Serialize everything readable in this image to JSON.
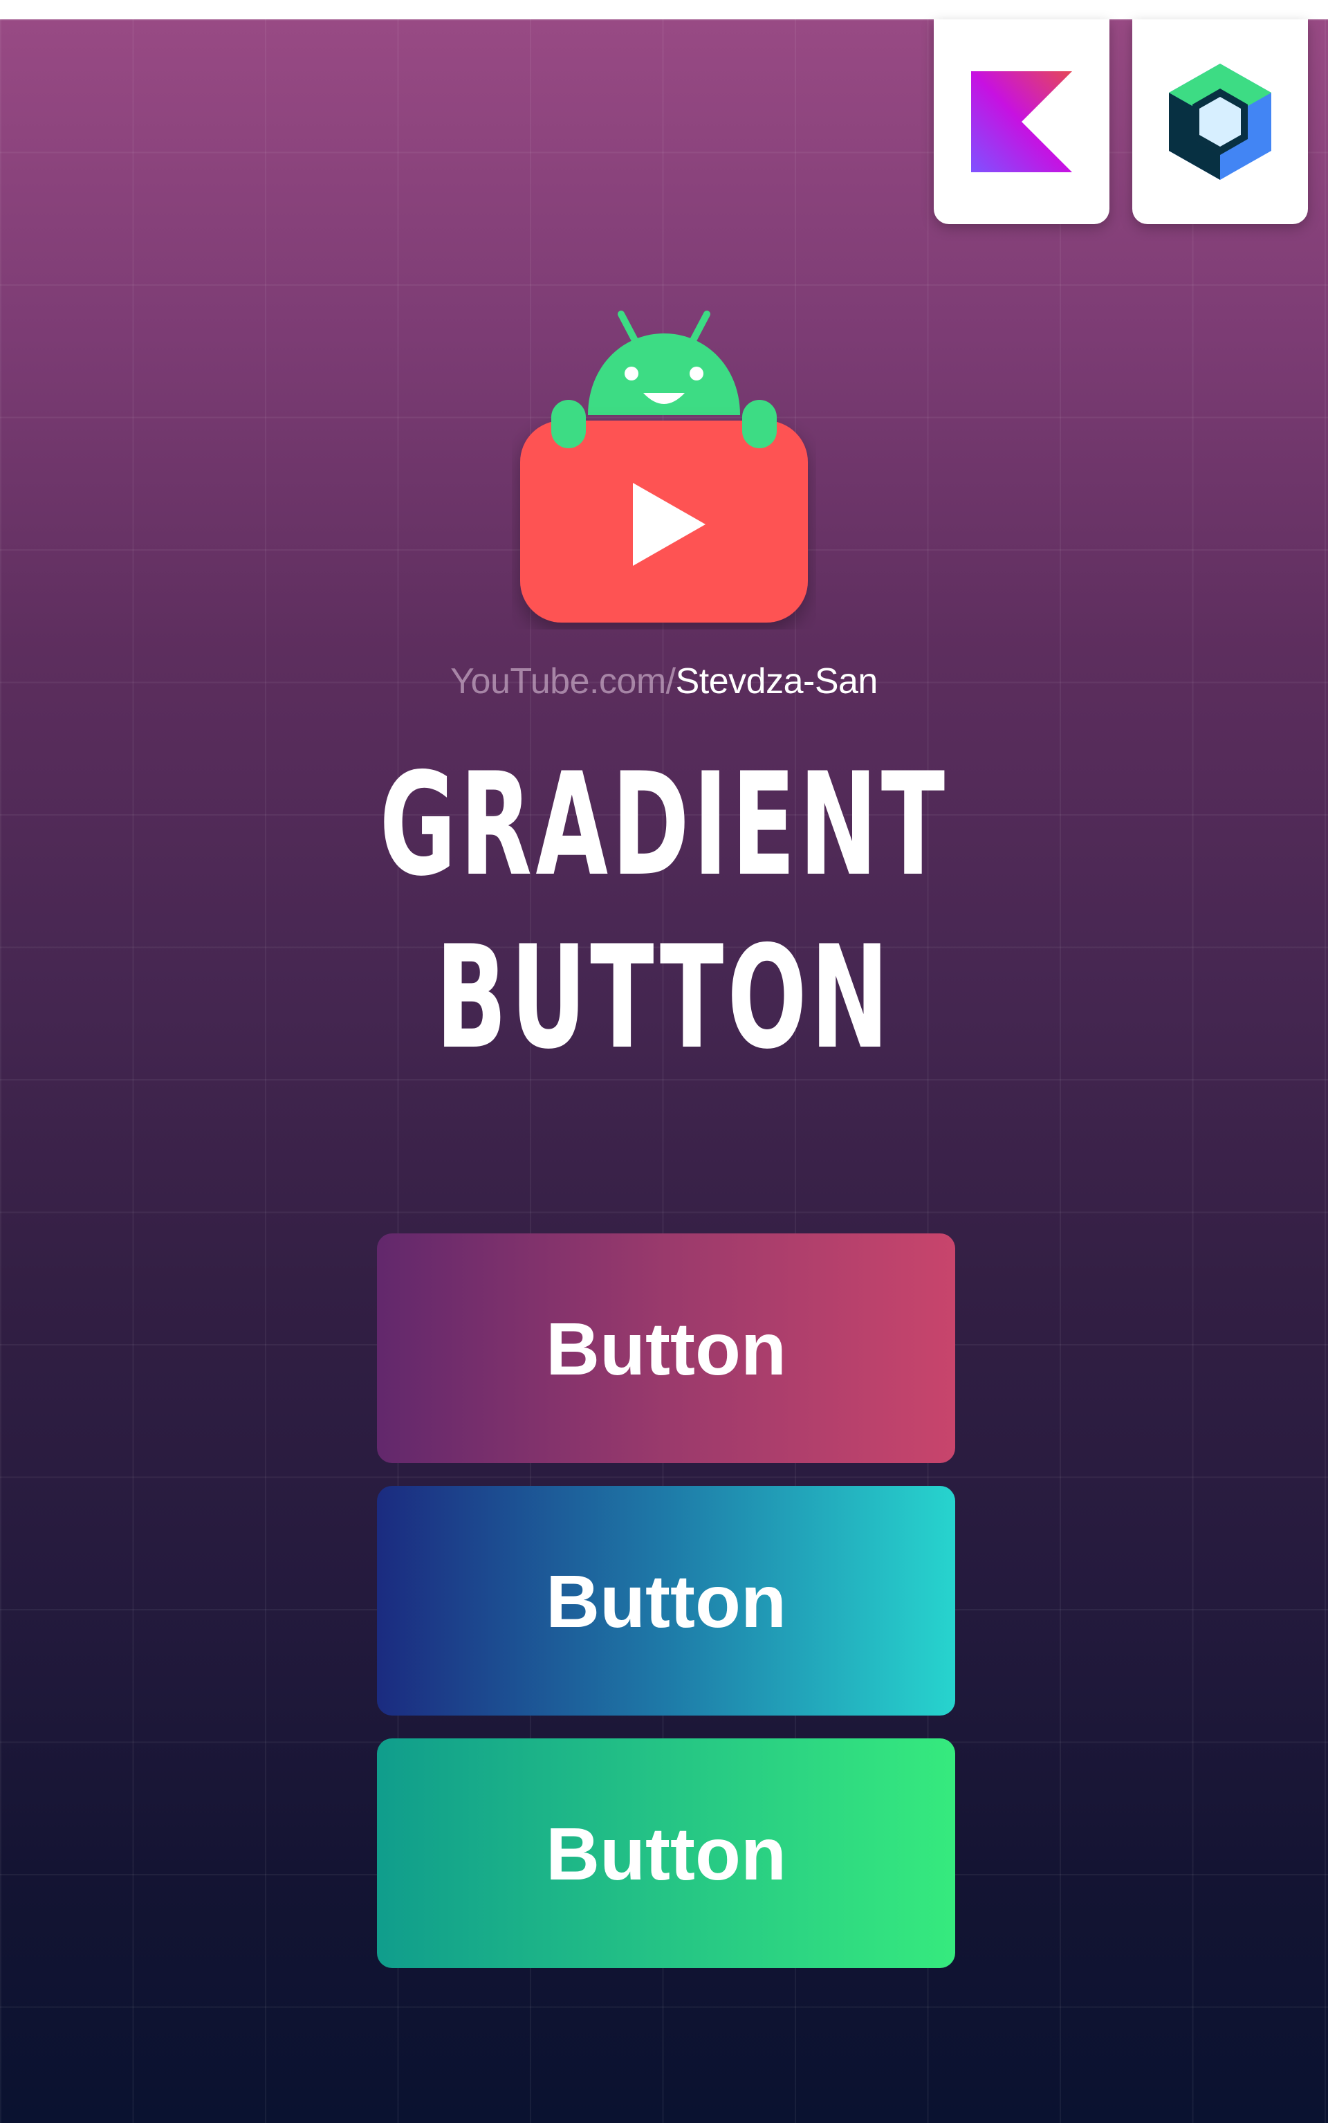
{
  "channel": {
    "url_prefix": "YouTube.com/",
    "url_handle": "Stevdza-San"
  },
  "headline": {
    "line1": "GRADIENT",
    "line2": "BUTTON"
  },
  "buttons": [
    {
      "label": "Button",
      "gradient": [
        "#62286c",
        "#c8456c"
      ]
    },
    {
      "label": "Button",
      "gradient": [
        "#1b2b80",
        "#27d4ce"
      ]
    },
    {
      "label": "Button",
      "gradient": [
        "#109d8c",
        "#36ea7e"
      ]
    }
  ],
  "icons": {
    "kotlin": "kotlin-logo-icon",
    "compose": "jetpack-compose-logo-icon",
    "channel": "youtube-android-logo-icon"
  },
  "colors": {
    "background_top": "#984a84",
    "background_bottom": "#0a1230",
    "youtube_red": "#fe5252",
    "android_green": "#3ddc84"
  }
}
